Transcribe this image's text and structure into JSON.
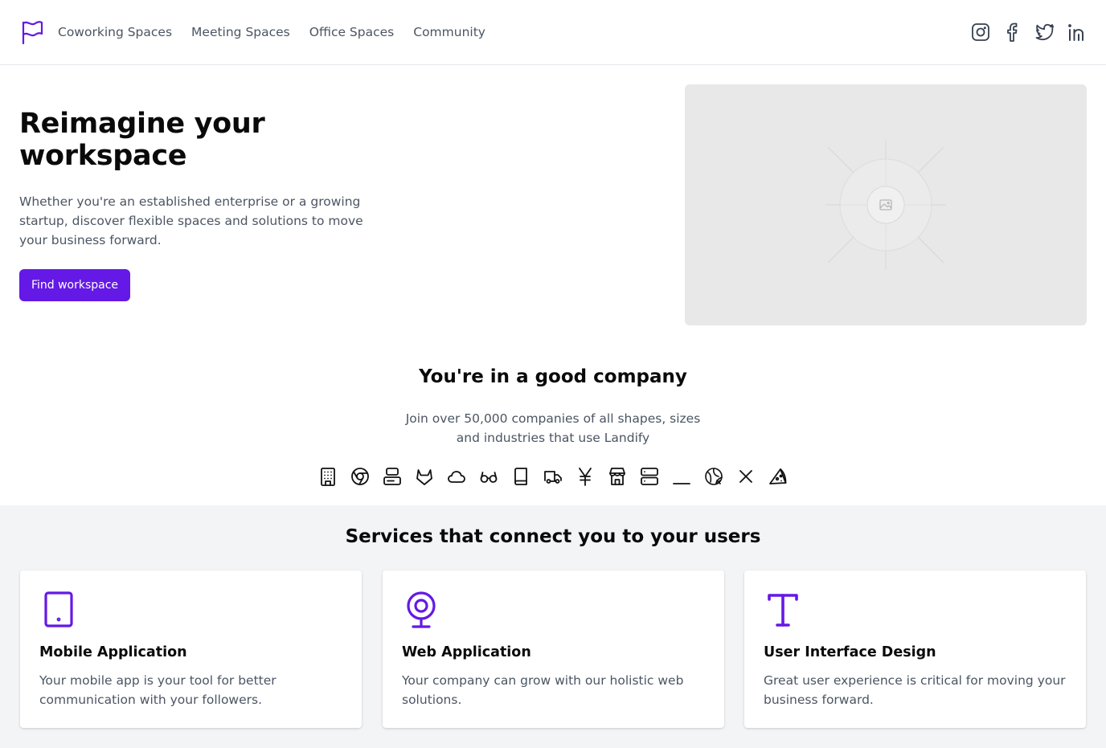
{
  "header": {
    "logo": "flag-icon",
    "nav": [
      "Coworking Spaces",
      "Meeting Spaces",
      "Office Spaces",
      "Community"
    ],
    "social": [
      "instagram-icon",
      "facebook-icon",
      "twitter-icon",
      "linkedin-icon"
    ]
  },
  "hero": {
    "title": "Reimagine your workspace",
    "subtitle": "Whether you're an established enterprise or a growing startup, discover flexible spaces and solutions to move your business forward.",
    "cta_label": "Find workspace",
    "image": "image-placeholder-icon"
  },
  "company": {
    "title": "You're in a good company",
    "subtitle": "Join over 50,000 companies of all shapes, sizes and industries that use Landify",
    "logos": [
      "building-icon",
      "chrome-icon",
      "server-stack-icon",
      "gitlab-icon",
      "cloud-icon",
      "glasses-icon",
      "book-icon",
      "truck-icon",
      "yen-icon",
      "store-icon",
      "server-icon",
      "underscore-icon",
      "hop-icon",
      "x-icon",
      "pizza-icon"
    ]
  },
  "services": {
    "title": "Services that connect you to your users",
    "cards": [
      {
        "icon": "tablet-icon",
        "title": "Mobile Application",
        "text": "Your mobile app is your tool for better communication with your followers."
      },
      {
        "icon": "webcam-icon",
        "title": "Web Application",
        "text": "Your company can grow with our holistic web solutions."
      },
      {
        "icon": "typography-icon",
        "title": "User Interface Design",
        "text": "Great user experience is critical for moving your business forward."
      }
    ]
  },
  "colors": {
    "accent": "#6419e6",
    "text_muted": "#4b5563",
    "section_bg": "#f3f4f6",
    "placeholder_bg": "#e8e8e8"
  }
}
